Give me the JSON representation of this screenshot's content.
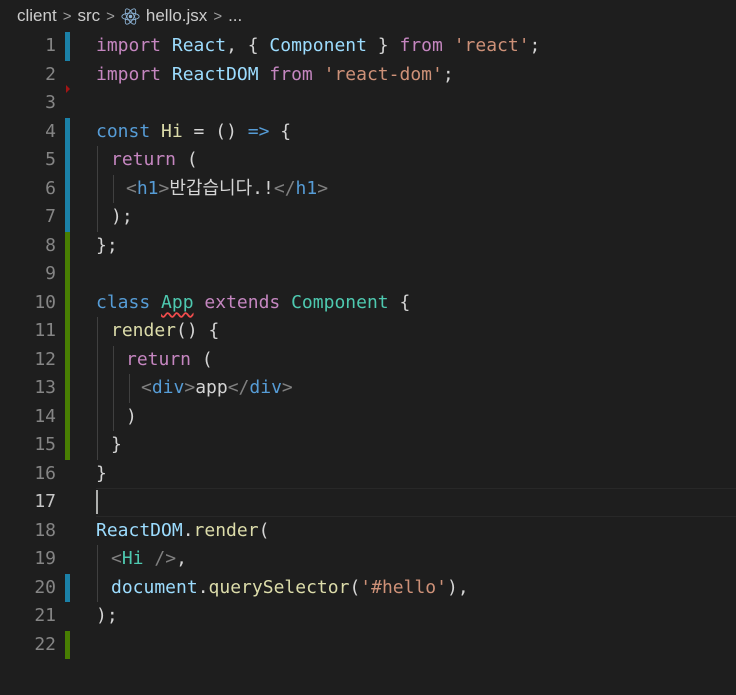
{
  "breadcrumb": {
    "items": [
      "client",
      "src",
      "hello.jsx",
      "..."
    ],
    "separator": ">",
    "file_icon": "react-icon"
  },
  "editor": {
    "language": "jsx",
    "current_line": 17,
    "lines": [
      {
        "n": "1",
        "text": "import React, { Component } from 'react';"
      },
      {
        "n": "2",
        "text": "import ReactDOM from 'react-dom';"
      },
      {
        "n": "3",
        "text": ""
      },
      {
        "n": "4",
        "text": "const Hi = () => {"
      },
      {
        "n": "5",
        "text": "  return ("
      },
      {
        "n": "6",
        "text": "    <h1>반갑습니다.!</h1>"
      },
      {
        "n": "7",
        "text": "  );"
      },
      {
        "n": "8",
        "text": "};"
      },
      {
        "n": "9",
        "text": ""
      },
      {
        "n": "10",
        "text": "class App extends Component {"
      },
      {
        "n": "11",
        "text": "  render() {"
      },
      {
        "n": "12",
        "text": "    return ("
      },
      {
        "n": "13",
        "text": "      <div>app</div>"
      },
      {
        "n": "14",
        "text": "    )"
      },
      {
        "n": "15",
        "text": "  }"
      },
      {
        "n": "16",
        "text": "}"
      },
      {
        "n": "17",
        "text": ""
      },
      {
        "n": "18",
        "text": "ReactDOM.render("
      },
      {
        "n": "19",
        "text": "  <Hi />,"
      },
      {
        "n": "20",
        "text": "  document.querySelector('#hello'),"
      },
      {
        "n": "21",
        "text": ");"
      },
      {
        "n": "22",
        "text": ""
      }
    ]
  },
  "colors": {
    "background": "#1e1e1e",
    "gutter_modified": "#1b81a8",
    "gutter_added": "#487e02",
    "keyword": "#c586c0",
    "storage": "#569cd6",
    "function": "#dcdcaa",
    "variable": "#9cdcfe",
    "class": "#4ec9b0",
    "string": "#ce9178"
  }
}
